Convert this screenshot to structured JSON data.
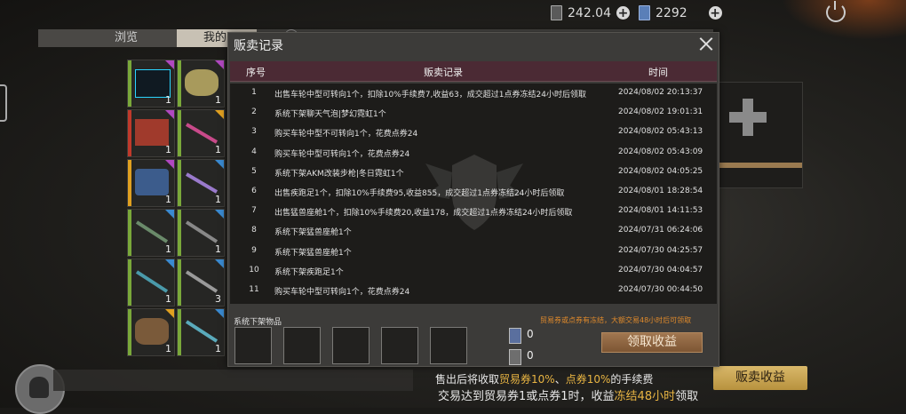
{
  "top_bar": {
    "currency1_value": "242.04",
    "currency2_value": "2292"
  },
  "tabs": [
    {
      "label": "浏览"
    },
    {
      "label": "我的"
    }
  ],
  "inventory_counts": [
    "1",
    "1",
    "1",
    "1",
    "1",
    "1",
    "1",
    "1",
    "1",
    "3",
    "1",
    "1"
  ],
  "footer": {
    "fee_prefix": "售出后将收取",
    "fee_ticket": "贸易券10%",
    "fee_sep": "、",
    "fee_points": "点券10%",
    "fee_suffix": "的手续费",
    "freeze_prefix": "交易达到贸易券1或点券1时，收益",
    "freeze_hl": "冻结48小时",
    "freeze_suffix": "领取",
    "sell_income_button": "贩卖收益"
  },
  "modal": {
    "title": "贩卖记录",
    "columns": {
      "index": "序号",
      "record": "贩卖记录",
      "time": "时间"
    },
    "rows": [
      {
        "index": "1",
        "record": "出售车轮中型可转向1个，扣除10%手续费7,收益63，成交超过1点券冻结24小时后领取",
        "time": "2024/08/02 20:13:37"
      },
      {
        "index": "2",
        "record": "系统下架聊天气泡|梦幻霓虹1个",
        "time": "2024/08/02 19:01:31"
      },
      {
        "index": "3",
        "record": "购买车轮中型不可转向1个，花费点券24",
        "time": "2024/08/02 05:43:13"
      },
      {
        "index": "4",
        "record": "购买车轮中型可转向1个，花费点券24",
        "time": "2024/08/02 05:43:09"
      },
      {
        "index": "5",
        "record": "系统下架AKM改装步枪|冬日霓虹1个",
        "time": "2024/08/02 04:05:25"
      },
      {
        "index": "6",
        "record": "出售疾跑足1个，扣除10%手续费95,收益855，成交超过1点券冻结24小时后领取",
        "time": "2024/08/01 18:28:54"
      },
      {
        "index": "7",
        "record": "出售猛兽座舱1个，扣除10%手续费20,收益178，成交超过1点券冻结24小时后领取",
        "time": "2024/08/01 14:11:53"
      },
      {
        "index": "8",
        "record": "系统下架猛兽座舱1个",
        "time": "2024/07/31 06:24:06"
      },
      {
        "index": "9",
        "record": "系统下架猛兽座舱1个",
        "time": "2024/07/30 04:25:57"
      },
      {
        "index": "10",
        "record": "系统下架疾跑足1个",
        "time": "2024/07/30 04:04:57"
      },
      {
        "index": "11",
        "record": "购买车轮中型可转向1个，花费点券24",
        "time": "2024/07/30 00:44:50"
      }
    ],
    "offline_label": "系统下架物品",
    "warning": "贸易券或点券有冻结，大额交易48小时后可领取",
    "ticket_count": "0",
    "points_count": "0",
    "claim_button": "领取收益"
  }
}
